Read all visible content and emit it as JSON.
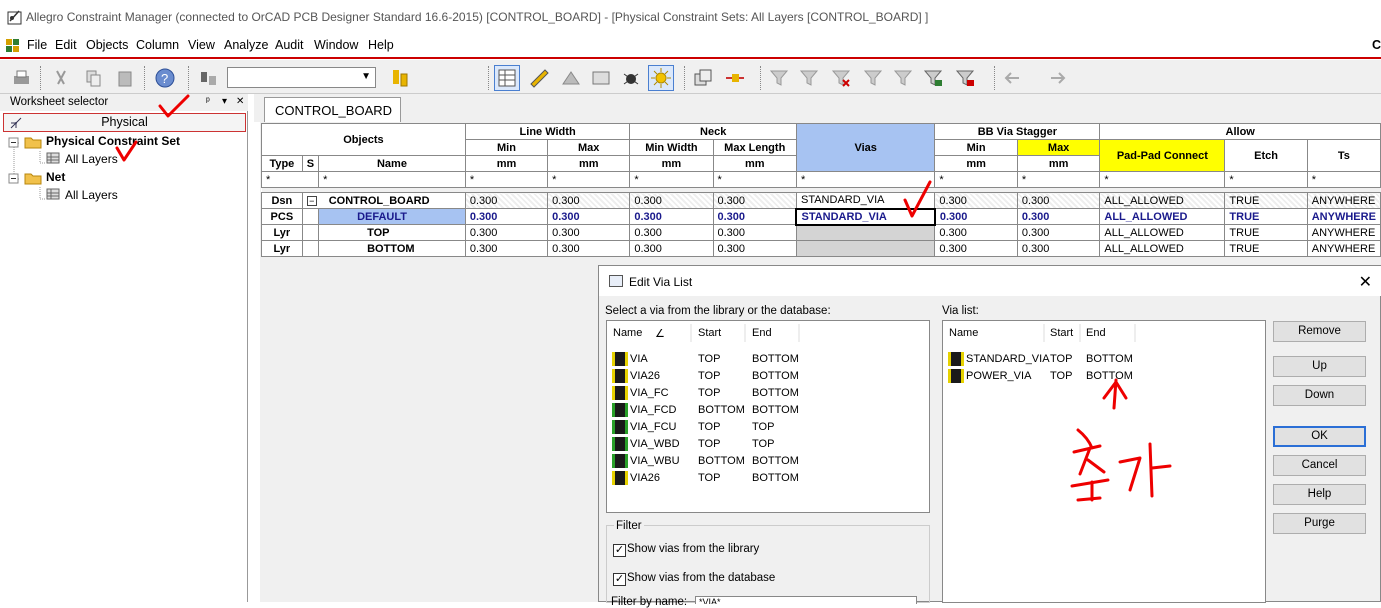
{
  "window": {
    "title": "Allegro Constraint Manager (connected to OrCAD PCB Designer Standard 16.6-2015) [CONTROL_BOARD] - [Physical Constraint Sets:  All Layers [CONTROL_BOARD] ]"
  },
  "menu": [
    "File",
    "Edit",
    "Objects",
    "Column",
    "View",
    "Analyze",
    "Audit",
    "Window",
    "Help"
  ],
  "menu_right": "C",
  "worksheet": {
    "title": "Worksheet selector",
    "pin": "ᵖ",
    "dropdown": "▾",
    "close": "✕",
    "physical": "Physical",
    "tree": [
      "Physical Constraint Set",
      "All Layers",
      "Net",
      "All Layers"
    ]
  },
  "tab": "CONTROL_BOARD",
  "grid": {
    "objects": "Objects",
    "line_width": "Line Width",
    "neck": "Neck",
    "vias": "Vias",
    "bb": "BB Via Stagger",
    "allow": "Allow",
    "min": "Min",
    "max": "Max",
    "min_width": "Min Width",
    "max_length": "Max Length",
    "pad": "Pad-Pad Connect",
    "etch": "Etch",
    "ts": "Ts",
    "type": "Type",
    "s": "S",
    "name": "Name",
    "mm": "mm",
    "star": "*",
    "rows": [
      {
        "type": "Dsn",
        "name": "CONTROL_BOARD",
        "exp": "−",
        "lwmin": "0.300",
        "lwmax": "0.300",
        "nmin": "0.300",
        "nmax": "0.300",
        "via": "STANDARD_VIA",
        "bmin": "0.300",
        "bmax": "0.300",
        "pad": "ALL_ALLOWED",
        "etch": "TRUE",
        "ts": "ANYWHERE"
      },
      {
        "type": "PCS",
        "name": "DEFAULT",
        "exp": "−",
        "lwmin": "0.300",
        "lwmax": "0.300",
        "nmin": "0.300",
        "nmax": "0.300",
        "via": "STANDARD_VIA",
        "bmin": "0.300",
        "bmax": "0.300",
        "pad": "ALL_ALLOWED",
        "etch": "TRUE",
        "ts": "ANYWHERE"
      },
      {
        "type": "Lyr",
        "name": "TOP",
        "exp": "",
        "lwmin": "0.300",
        "lwmax": "0.300",
        "nmin": "0.300",
        "nmax": "0.300",
        "via": "",
        "bmin": "0.300",
        "bmax": "0.300",
        "pad": "ALL_ALLOWED",
        "etch": "TRUE",
        "ts": "ANYWHERE"
      },
      {
        "type": "Lyr",
        "name": "BOTTOM",
        "exp": "",
        "lwmin": "0.300",
        "lwmax": "0.300",
        "nmin": "0.300",
        "nmax": "0.300",
        "via": "",
        "bmin": "0.300",
        "bmax": "0.300",
        "pad": "ALL_ALLOWED",
        "etch": "TRUE",
        "ts": "ANYWHERE"
      }
    ]
  },
  "dialog": {
    "title": "Edit Via List",
    "close": "✕",
    "select_label": "Select a via from the library or the database:",
    "via_list_label": "Via list:",
    "col_name": "Name",
    "col_start": "Start",
    "col_end": "End",
    "sort_mark": "∠",
    "library": [
      {
        "name": "VIA",
        "start": "TOP",
        "end": "BOTTOM",
        "icon": "yellow"
      },
      {
        "name": "VIA26",
        "start": "TOP",
        "end": "BOTTOM",
        "icon": "yellow"
      },
      {
        "name": "VIA_FC",
        "start": "TOP",
        "end": "BOTTOM",
        "icon": "yellow"
      },
      {
        "name": "VIA_FCD",
        "start": "BOTTOM",
        "end": "BOTTOM",
        "icon": "green"
      },
      {
        "name": "VIA_FCU",
        "start": "TOP",
        "end": "TOP",
        "icon": "green"
      },
      {
        "name": "VIA_WBD",
        "start": "TOP",
        "end": "TOP",
        "icon": "green"
      },
      {
        "name": "VIA_WBU",
        "start": "BOTTOM",
        "end": "BOTTOM",
        "icon": "green"
      },
      {
        "name": "VIA26",
        "start": "TOP",
        "end": "BOTTOM",
        "icon": "yellow"
      }
    ],
    "selected": [
      {
        "name": "STANDARD_VIA",
        "start": "TOP",
        "end": "BOTTOM"
      },
      {
        "name": "POWER_VIA",
        "start": "TOP",
        "end": "BOTTOM"
      }
    ],
    "buttons": [
      "Remove",
      "Up",
      "Down",
      "OK",
      "Cancel",
      "Help",
      "Purge"
    ],
    "filter": "Filter",
    "show_library": "Show vias from the library",
    "show_database": "Show vias from the database",
    "filter_by_name": "Filter by name:",
    "filter_value": "*VIA*",
    "check": "✓"
  },
  "annotation": {
    "text": "추가",
    "color": "#e00000"
  }
}
